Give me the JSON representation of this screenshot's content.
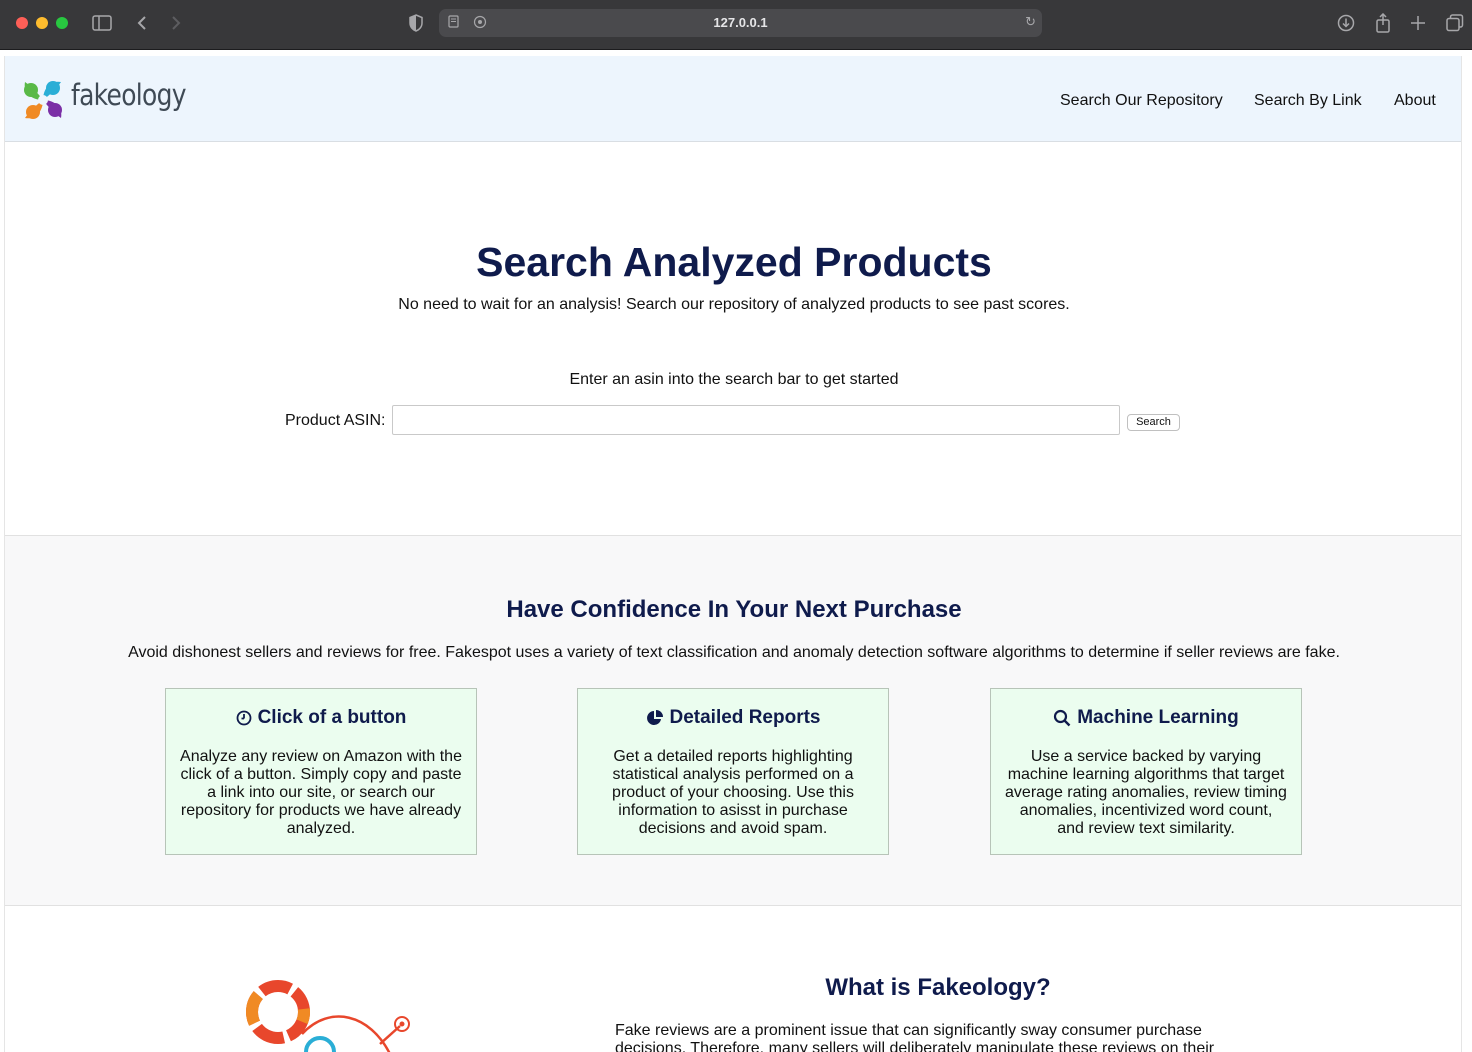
{
  "browser": {
    "url": "127.0.0.1"
  },
  "navbar": {
    "logo_text": "fakeology",
    "links": [
      "Search Our Repository",
      "Search By Link",
      "About"
    ]
  },
  "hero": {
    "title": "Search Analyzed Products",
    "subtitle": "No need to wait for an analysis! Search our repository of analyzed products to see past scores.",
    "hint": "Enter an asin into the search bar to get started",
    "input_label": "Product ASIN:",
    "input_value": "",
    "button_label": "Search"
  },
  "features": {
    "title": "Have Confidence In Your Next Purchase",
    "subtitle": "Avoid dishonest sellers and reviews for free. Fakespot uses a variety of text classification and anomaly detection software algorithms to determine if seller reviews are fake.",
    "cards": [
      {
        "icon": "clock-icon",
        "title": "Click of a button",
        "body": "Analyze any review on Amazon with the click of a button. Simply copy and paste a link into our site, or search our repository for products we have already analyzed."
      },
      {
        "icon": "pie-chart-icon",
        "title": "Detailed Reports",
        "body": "Get a detailed reports highlighting statistical analysis performed on a product of your choosing. Use this information to asisst in purchase decisions and avoid spam."
      },
      {
        "icon": "search-icon",
        "title": "Machine Learning",
        "body": "Use a service backed by varying machine learning algorithms that target average rating anomalies, review timing anomalies, incentivized word count, and review text similarity."
      }
    ]
  },
  "about": {
    "title": "What is Fakeology?",
    "body": "Fake reviews are a prominent issue that can significantly sway consumer purchase decisions. Therefore, many sellers will deliberately manipulate these reviews on their"
  },
  "colors": {
    "navbar_bg": "#edf5fd",
    "heading": "#0f1b4c",
    "card_bg": "#ebfdef",
    "features_bg": "#f8f8f9"
  }
}
